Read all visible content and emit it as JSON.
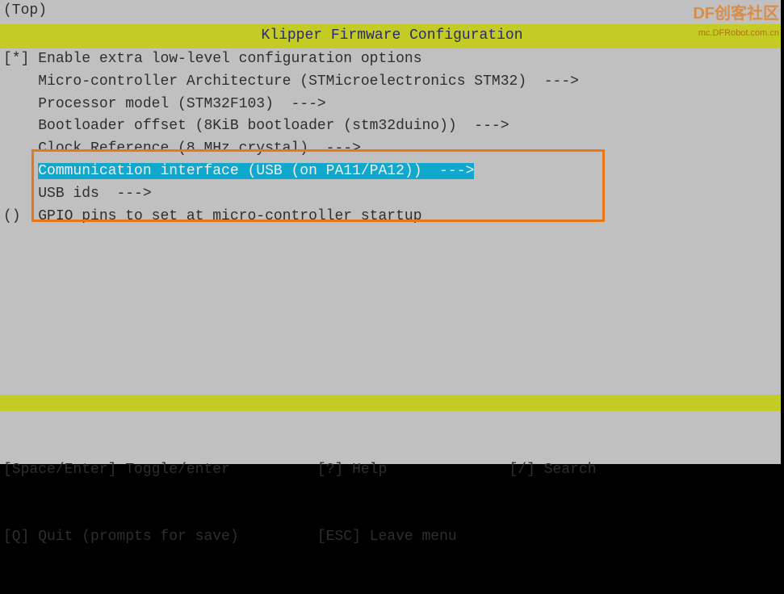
{
  "breadcrumb": "(Top)",
  "title": "Klipper Firmware Configuration",
  "watermark": {
    "line1": "DF创客社区",
    "line2": "mc.DFRobot.com.cn"
  },
  "menu": [
    {
      "prefix": "[*] ",
      "label": "Enable extra low-level configuration options",
      "suffix": ""
    },
    {
      "prefix": "    ",
      "label": "Micro-controller Architecture (STMicroelectronics STM32)",
      "suffix": "  --->"
    },
    {
      "prefix": "    ",
      "label": "Processor model (STM32F103)",
      "suffix": "  --->"
    },
    {
      "prefix": "    ",
      "label": "Bootloader offset (8KiB bootloader (stm32duino))",
      "suffix": "  --->"
    },
    {
      "prefix": "    ",
      "label": "Clock Reference (8 MHz crystal)",
      "suffix": "  --->"
    },
    {
      "prefix": "    ",
      "label": "Communication interface (USB (on PA11/PA12))",
      "suffix": "  --->"
    },
    {
      "prefix": "    ",
      "label": "USB ids",
      "suffix": "  --->"
    },
    {
      "prefix": "()  ",
      "label": "GPIO pins to set at micro-controller startup",
      "suffix": ""
    }
  ],
  "selected_index": 5,
  "help": {
    "line1": "[Space/Enter] Toggle/enter          [?] Help              [/] Search",
    "line2": "[Q] Quit (prompts for save)         [ESC] Leave menu"
  }
}
